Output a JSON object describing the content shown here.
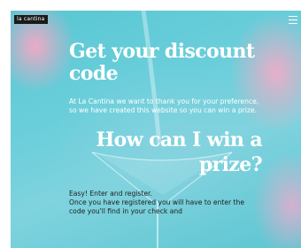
{
  "header": {
    "logo_text": "la cantina",
    "menu_icon": "hamburger-menu-icon"
  },
  "hero": {
    "title": "Get your discount code",
    "intro": "At La Cantina we want to thank you for your preference, so we have created this website so you can win a prize.",
    "section_title": "How can I win a prize?",
    "steps_line1": "Easy! Enter and register.",
    "steps_line2": "Once you have registered you will have to enter the code you'll find in your check and"
  },
  "colors": {
    "background": "#5fc8d4",
    "accent_pink": "#f5a8c4",
    "text_light": "#ffffff",
    "text_dark": "#1d1d1d"
  }
}
